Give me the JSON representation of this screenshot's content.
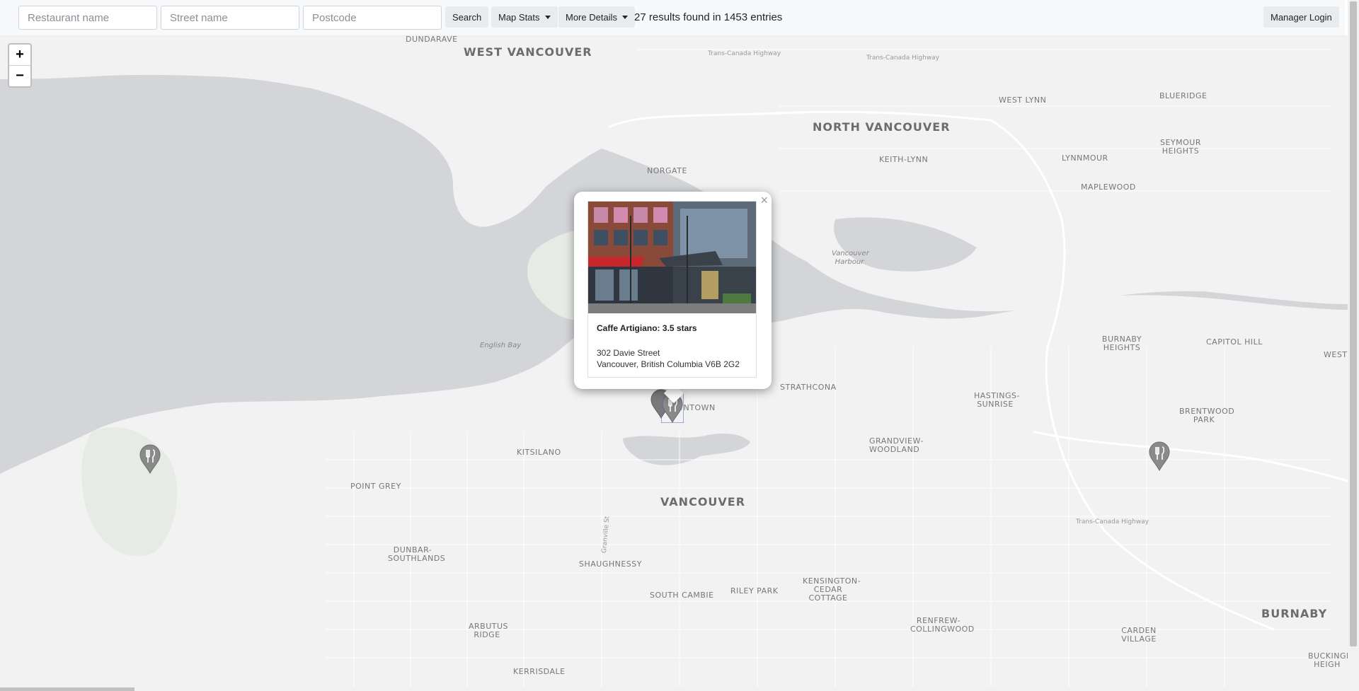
{
  "search": {
    "restaurant_placeholder": "Restaurant name",
    "street_placeholder": "Street name",
    "postcode_placeholder": "Postcode",
    "search_label": "Search",
    "map_stats_label": "Map Stats",
    "more_details_label": "More Details",
    "results_text": "27 results found in 1453 entries",
    "manager_login_label": "Manager Login"
  },
  "map": {
    "zoom_in": "+",
    "zoom_out": "−",
    "labels": {
      "west_vancouver": "WEST VANCOUVER",
      "north_vancouver": "NORTH VANCOUVER",
      "vancouver": "VANCOUVER",
      "burnaby": "BURNABY",
      "dundarave": "DUNDARAVE",
      "norgate": "NORGATE",
      "west_lynn": "WEST LYNN",
      "blueridge": "BLUERIDGE",
      "seymour_heights": "SEYMOUR HEIGHTS",
      "keith_lynn": "KEITH-LYNN",
      "lynnmour": "LYNNMOUR",
      "maplewood": "MAPLEWOOD",
      "vancouver_harbour": "Vancouver Harbour",
      "english_bay": "English Bay",
      "burnaby_heights": "BURNABY HEIGHTS",
      "capitol_hill": "CAPITOL HILL",
      "west": "WEST",
      "strathcona": "STRATHCONA",
      "hastings_sunrise": "HASTINGS-SUNRISE",
      "brentwood_park": "BRENTWOOD PARK",
      "grandview_woodland": "GRANDVIEW-WOODLAND",
      "kitsilano": "KITSILANO",
      "point_grey": "POINT GREY",
      "downtown": "DOWNTOWN",
      "dunbar_southlands": "DUNBAR-SOUTHLANDS",
      "shaughnessy": "SHAUGHNESSY",
      "south_cambie": "SOUTH CAMBIE",
      "riley_park": "RILEY PARK",
      "kensington_cedar_cottage": "KENSINGTON-CEDAR COTTAGE",
      "renfrew_collingwood": "RENFREW-COLLINGWOOD",
      "carden_village": "CARDEN VILLAGE",
      "arbutus_ridge": "ARBUTUS RIDGE",
      "kerrisdale": "KERRISDALE",
      "buckingham_heights": "BUCKINGH HEIGH",
      "trans_canada_highway": "Trans-Canada Highway",
      "granville_st": "Granville St"
    }
  },
  "popup": {
    "close": "×",
    "title": "Caffe Artigiano: 3.5 stars",
    "address_line1": "302 Davie Street",
    "address_line2": "Vancouver, British Columbia V6B 2G2"
  },
  "colors": {
    "water": "#d3d5d8",
    "land": "#f2f2f2",
    "park": "#e7ebe5",
    "marker": "#8a8a8a"
  },
  "icons": {
    "marker": "restaurant-marker-icon",
    "close": "close-icon",
    "caret": "caret-down-icon"
  }
}
